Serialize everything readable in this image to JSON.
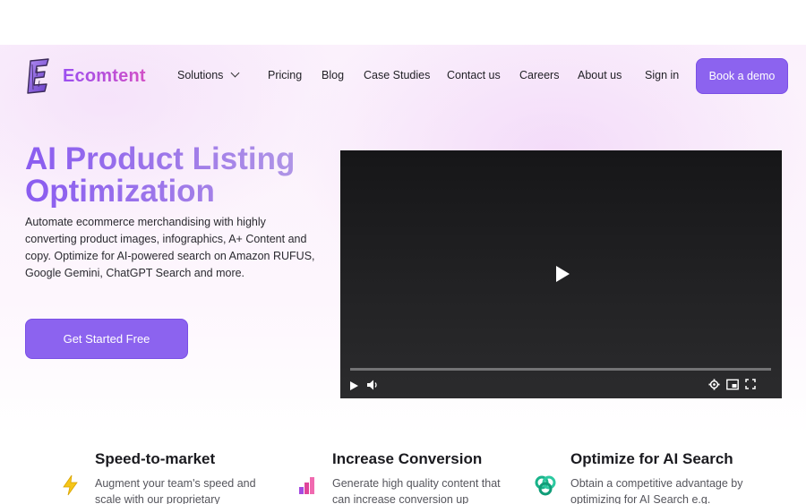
{
  "brand": {
    "name": "Ecomtent",
    "accent": "#8c63ef",
    "logo_gradient": [
      "#9b4ff0",
      "#d24fc6"
    ]
  },
  "nav": {
    "items": [
      {
        "label": "Solutions",
        "has_dropdown": true
      },
      {
        "label": "Pricing"
      },
      {
        "label": "Blog"
      },
      {
        "label": "Case Studies"
      },
      {
        "label": "Contact us"
      },
      {
        "label": "Careers"
      },
      {
        "label": "About us"
      }
    ],
    "sign_in": "Sign in",
    "demo_button": "Book a demo"
  },
  "hero": {
    "title": "AI Product Listing Optimization",
    "description": "Automate ecommerce merchandising with highly converting product images, infographics, A+ Content and copy. Optimize for AI-powered search on Amazon RUFUS, Google Gemini, ChatGPT Search and more.",
    "cta": "Get Started Free"
  },
  "video": {
    "controls": [
      "play-icon",
      "volume-icon",
      "settings-icon",
      "miniplayer-icon",
      "fullscreen-icon"
    ],
    "progress": 0
  },
  "features": [
    {
      "icon": "lightning-icon",
      "title": "Speed-to-market",
      "description": "Augment your team's speed and scale with our proprietary",
      "color": "#f5c518"
    },
    {
      "icon": "bar-chart-icon",
      "title": "Increase Conversion",
      "description": "Generate high quality content that can increase conversion up",
      "color": "#e0449a"
    },
    {
      "icon": "ai-knot-icon",
      "title": "Optimize for AI Search",
      "description": "Obtain a competitive advantage by optimizing for AI Search e.g.",
      "color": "#19b38a"
    }
  ]
}
